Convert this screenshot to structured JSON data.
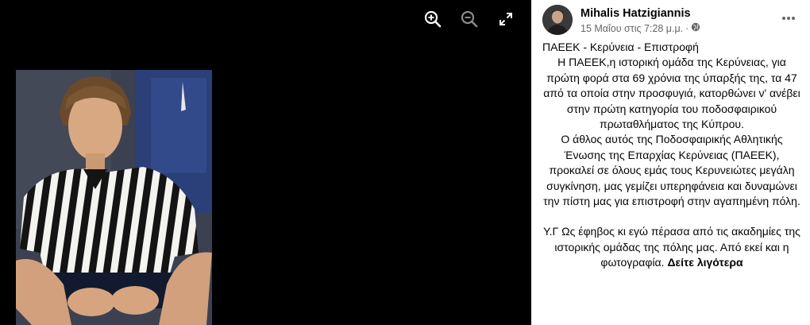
{
  "viewer": {
    "photo_alt": "",
    "controls": [
      "zoom-in-icon",
      "zoom-out-icon",
      "fullscreen-icon"
    ]
  },
  "post": {
    "author": "Mihalis Hatzigiannis",
    "date": "15 Μαΐου στις 7:28 μ.μ.",
    "separator": "·",
    "privacy_icon": "globe-icon",
    "title": "ΠΑΕΕΚ - Κερύνεια - Επιστροφή",
    "para1": "Η ΠΑΕΕΚ,η ιστορική ομάδα της Κερύνειας, για πρώτη φορά στα 69 χρόνια της ύπαρξής της, τα 47 από τα οποία στην προσφυγιά, κατορθώνει ν' ανέβει στην πρώτη κατηγορία του ποδοσφαιρικού πρωταθλήματος της Κύπρου.",
    "para2": "Ο άθλος αυτός της Ποδοσφαιρικής Αθλητικής Ένωσης της Επαρχίας Κερύνειας (ΠΑΕΕΚ), προκαλεί σε όλους εμάς τους Κερυνειώτες μεγάλη συγκίνηση, μας γεμίζει υπερηφάνεια και δυναμώνει την πίστη μας για επιστροφή στην αγαπημένη πόλη.",
    "para3": "Υ.Γ Ως έφηβος κι εγώ πέρασα από τις ακαδημίες της ιστορικής ομάδας της πόλης μας. Από εκεί και η φωτογραφία.",
    "see_more": "Δείτε λιγότερα"
  }
}
